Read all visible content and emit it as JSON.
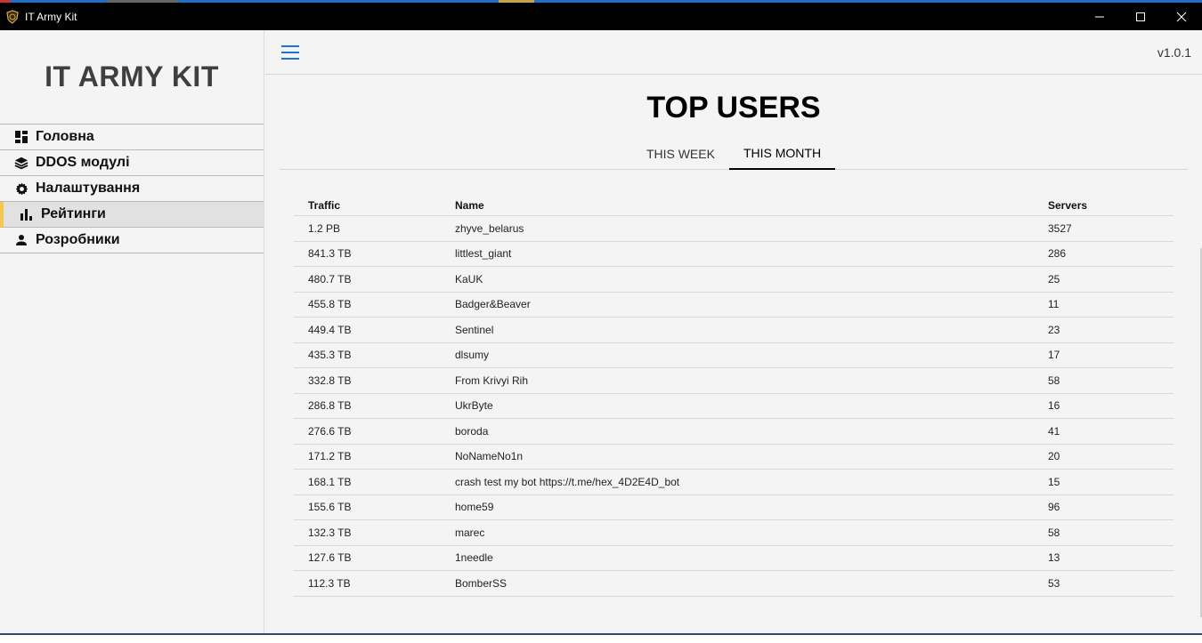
{
  "window": {
    "title": "IT Army Kit",
    "controls": [
      "minimize",
      "maximize",
      "close"
    ]
  },
  "sidebar": {
    "brand": "IT ARMY KIT",
    "items": [
      {
        "label": "Головна",
        "icon": "dashboard-icon",
        "active": false
      },
      {
        "label": "DDOS модулі",
        "icon": "layers-icon",
        "active": false
      },
      {
        "label": "Налаштування",
        "icon": "gear-icon",
        "active": false
      },
      {
        "label": "Рейтинги",
        "icon": "bar-chart-icon",
        "active": true
      },
      {
        "label": "Розробники",
        "icon": "person-icon",
        "active": false
      }
    ],
    "accent_color": "#f2c94c"
  },
  "topbar": {
    "menu_icon": "hamburger-icon",
    "menu_color": "#1976d2",
    "version": "v1.0.1"
  },
  "main": {
    "title": "TOP USERS",
    "tabs": [
      {
        "label": "THIS WEEK",
        "active": false
      },
      {
        "label": "THIS MONTH",
        "active": true
      }
    ],
    "table": {
      "columns": [
        "Traffic",
        "Name",
        "Servers"
      ],
      "rows": [
        [
          "1.2 PB",
          "zhyve_belarus",
          "3527"
        ],
        [
          "841.3 TB",
          "littlest_giant",
          "286"
        ],
        [
          "480.7 TB",
          "KaUK",
          "25"
        ],
        [
          "455.8 TB",
          "Badger&Beaver",
          "11"
        ],
        [
          "449.4 TB",
          "Sentinel",
          "23"
        ],
        [
          "435.3 TB",
          "dlsumy",
          "17"
        ],
        [
          "332.8 TB",
          "From Krivyi Rih",
          "58"
        ],
        [
          "286.8 TB",
          "UkrByte",
          "16"
        ],
        [
          "276.6 TB",
          "boroda",
          "41"
        ],
        [
          "171.2 TB",
          "NoNameNo1n",
          "20"
        ],
        [
          "168.1 TB",
          "crash test my bot https://t.me/hex_4D2E4D_bot",
          "15"
        ],
        [
          "155.6 TB",
          "home59",
          "96"
        ],
        [
          "132.3 TB",
          "marec",
          "58"
        ],
        [
          "127.6 TB",
          "1needle",
          "13"
        ],
        [
          "112.3 TB",
          "BomberSS",
          "53"
        ]
      ]
    }
  }
}
